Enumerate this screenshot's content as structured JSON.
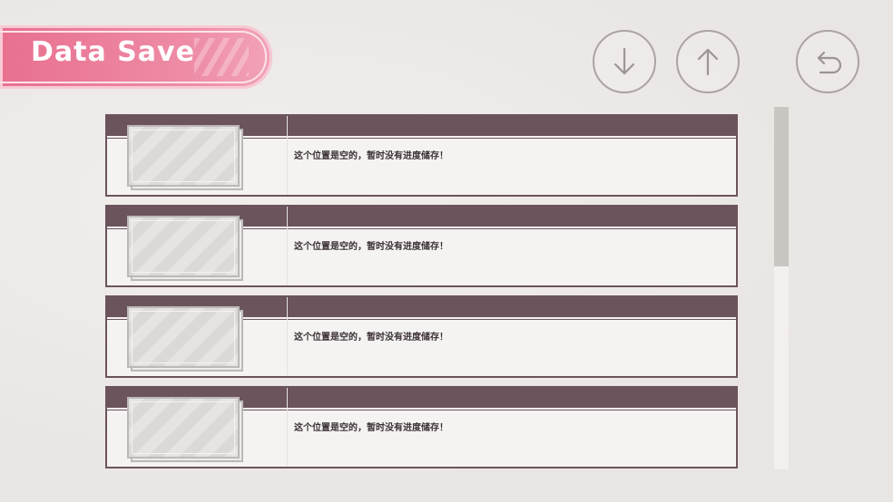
{
  "header": {
    "title": "Data Save"
  },
  "toolbar": {
    "buttons": [
      {
        "name": "scroll-down-button",
        "icon": "arrow-down-icon"
      },
      {
        "name": "scroll-up-button",
        "icon": "arrow-up-icon"
      },
      {
        "name": "back-button",
        "icon": "return-arrow-icon"
      }
    ]
  },
  "slots": [
    {
      "description": "这个位置是空的，暂时没有进度储存！"
    },
    {
      "description": "这个位置是空的，暂时没有进度储存！"
    },
    {
      "description": "这个位置是空的，暂时没有进度储存！"
    },
    {
      "description": "这个位置是空的，暂时没有进度储存！"
    }
  ],
  "colors": {
    "accent_pink": "#e8708f",
    "slot_header": "#6b545c",
    "background": "#ece8e6"
  },
  "scrollbar": {
    "position_fraction": 0.0,
    "visible_fraction": 0.44
  }
}
